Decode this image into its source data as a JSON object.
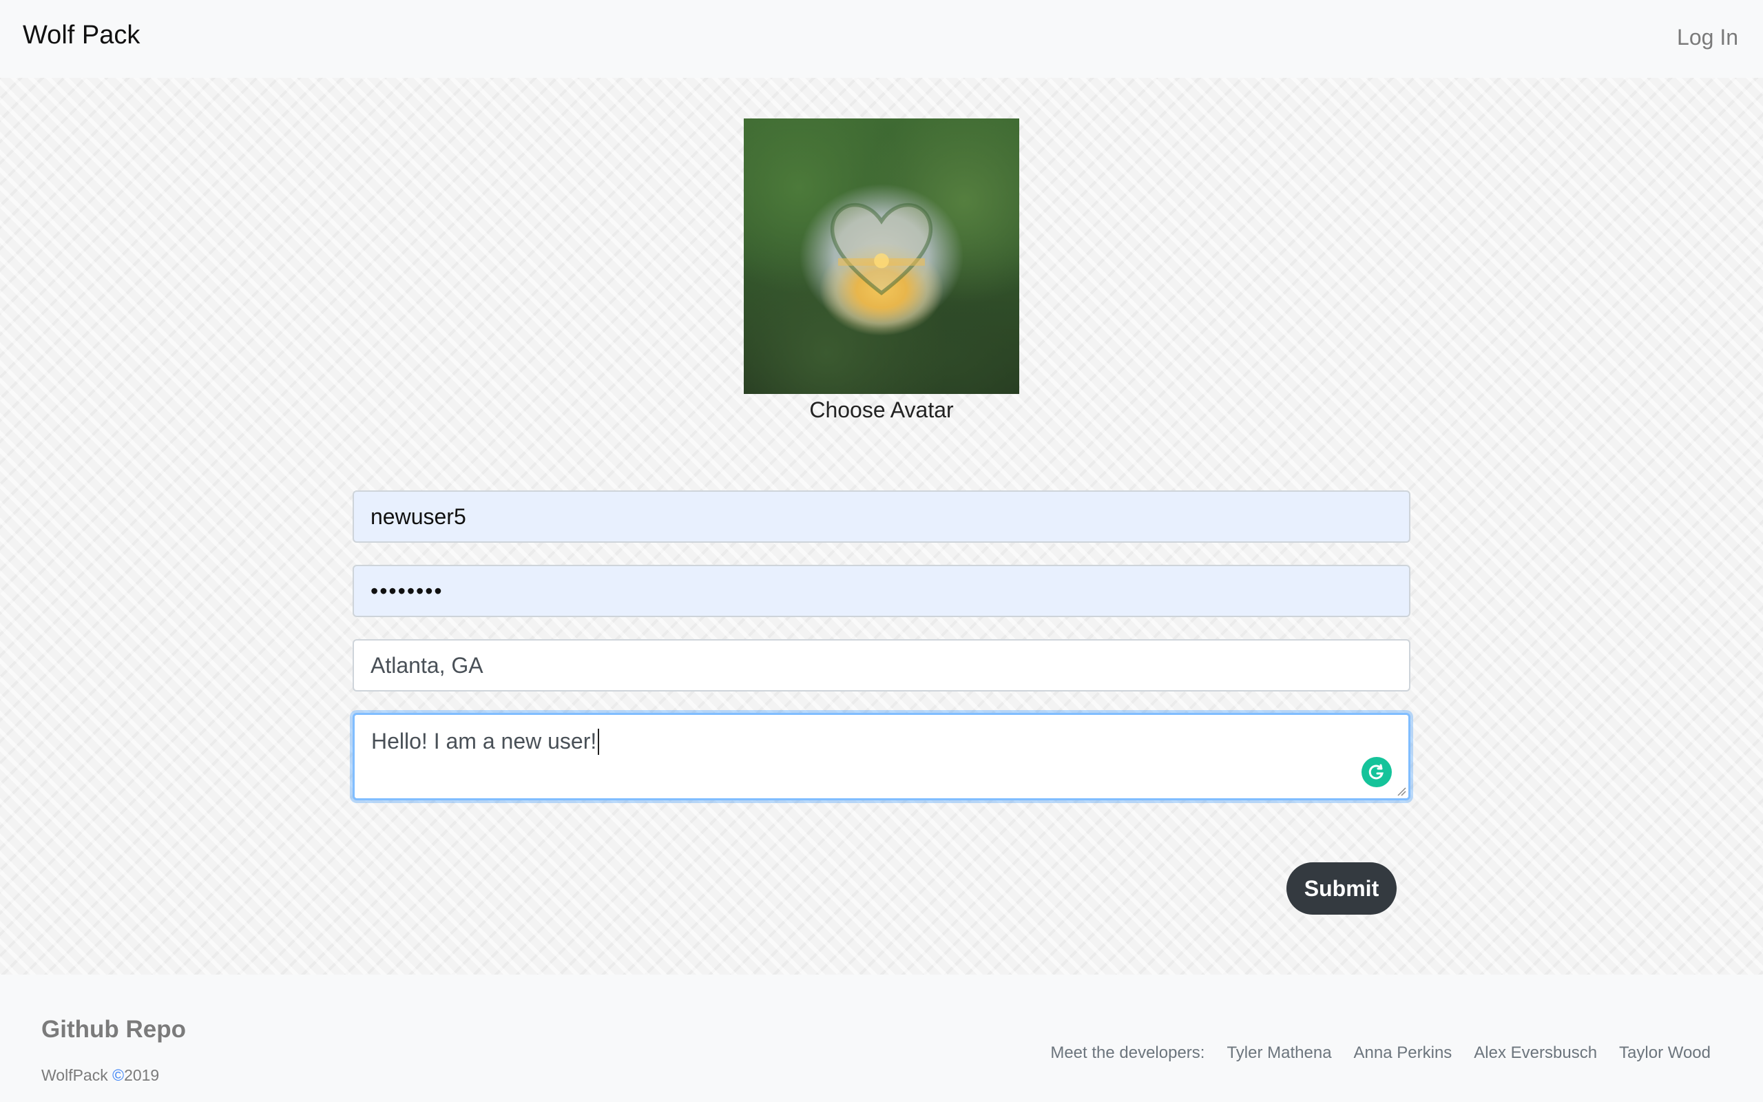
{
  "navbar": {
    "brand": "Wolf Pack",
    "login_label": "Log In"
  },
  "avatar": {
    "caption": "Choose Avatar"
  },
  "form": {
    "username_value": "newuser5",
    "password_mask": "••••••••",
    "location_value": "Atlanta, GA",
    "bio_value": "Hello! I am a new user!",
    "submit_label": "Submit"
  },
  "footer": {
    "github_label": "Github Repo",
    "brand": "WolfPack ",
    "copyright_symbol": "©",
    "year": "2019",
    "devs_heading": "Meet the developers:",
    "developers": [
      "Tyler Mathena",
      "Anna Perkins",
      "Alex Eversbusch",
      "Taylor Wood"
    ]
  },
  "colors": {
    "navbar_bg": "#f8f9fa",
    "autofill_bg": "#e8f0fe",
    "submit_bg": "#343a40",
    "focus_border": "#80bdff",
    "grammarly": "#15c39a"
  },
  "icons": {
    "grammarly": "grammarly-icon",
    "resize": "resize-handle-icon"
  }
}
